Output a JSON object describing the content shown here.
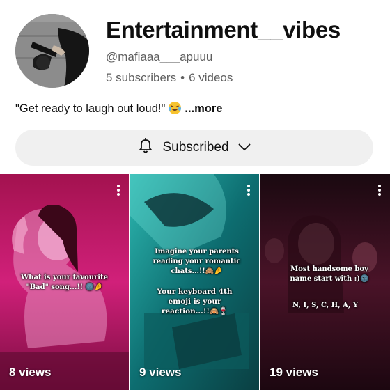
{
  "channel": {
    "name": "Entertainment__vibes",
    "handle": "@mafiaaa___apuuu",
    "subscribers": "5 subscribers",
    "separator": "•",
    "videos": "6 videos",
    "description": "\"Get ready to laugh out loud!\"",
    "description_emoji": "laughing-emoji",
    "more_label": "...more"
  },
  "subscribe_button": {
    "label": "Subscribed",
    "icon": "bell-icon",
    "dropdown_icon": "chevron-down-icon"
  },
  "shorts": [
    {
      "views": "8 views",
      "caption": "What is your favourite \"Bad\" song...!! 🌚🤌",
      "bg_color": "#c2186b"
    },
    {
      "views": "9 views",
      "caption": "Imagine your parents reading your romantic chats...!!🙈🤌",
      "caption2": "Your keyboard 4th emoji is your reaction...!!🙈🍷",
      "bg_color": "#0f7f7f"
    },
    {
      "views": "19 views",
      "caption": "Most handsome boy name start with :)🌚",
      "caption2": "N, I, S, C, H, A, Y",
      "bg_color": "#3a0c1f"
    }
  ]
}
